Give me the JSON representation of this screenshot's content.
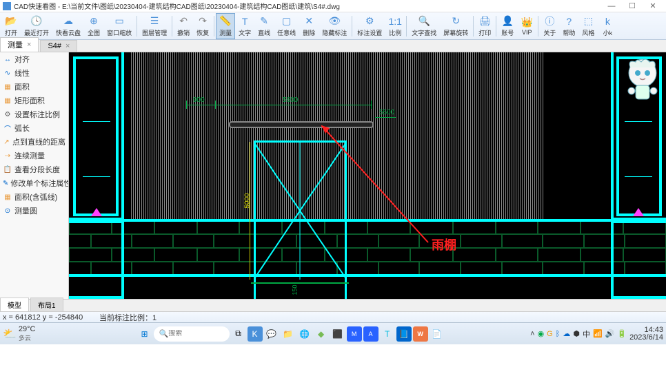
{
  "window": {
    "title": "CAD快速看图 - E:\\当前文件\\图纸\\20230404-建筑结构CAD图纸\\20230404-建筑结构CAD图纸\\建筑\\S4#.dwg",
    "min": "—",
    "max": "☐",
    "close": "✕"
  },
  "ribbon": [
    {
      "icon": "📂",
      "label": "打开",
      "c": "#4a90d9"
    },
    {
      "icon": "🕓",
      "label": "最近打开",
      "c": "#4a90d9"
    },
    {
      "icon": "☁",
      "label": "快看云盘",
      "c": "#4a90d9"
    },
    {
      "icon": "⊕",
      "label": "全图",
      "c": "#4a90d9"
    },
    {
      "icon": "▭",
      "label": "窗口缩放",
      "c": "#4a90d9"
    },
    {
      "sep": true
    },
    {
      "icon": "☰",
      "label": "图层管理",
      "c": "#4a90d9"
    },
    {
      "sep": true
    },
    {
      "icon": "↶",
      "label": "撤销",
      "c": "#888"
    },
    {
      "icon": "↷",
      "label": "恢复",
      "c": "#888"
    },
    {
      "sep": true
    },
    {
      "icon": "📏",
      "label": "测量",
      "c": "#4a90d9",
      "active": true
    },
    {
      "icon": "T",
      "label": "文字",
      "c": "#4a90d9"
    },
    {
      "icon": "✎",
      "label": "直线",
      "c": "#4a90d9"
    },
    {
      "icon": "▢",
      "label": "任意线",
      "c": "#4a90d9"
    },
    {
      "icon": "✕",
      "label": "删除",
      "c": "#4a90d9"
    },
    {
      "icon": "👁",
      "label": "隐藏标注",
      "c": "#4a90d9"
    },
    {
      "sep": true
    },
    {
      "icon": "⚙",
      "label": "标注设置",
      "c": "#4a90d9"
    },
    {
      "icon": "1:1",
      "label": "比例",
      "c": "#4a90d9"
    },
    {
      "sep": true
    },
    {
      "icon": "🔍",
      "label": "文字查找",
      "c": "#4a90d9"
    },
    {
      "icon": "↻",
      "label": "屏幕旋转",
      "c": "#4a90d9"
    },
    {
      "sep": true
    },
    {
      "icon": "🖨",
      "label": "打印",
      "c": "#4a90d9"
    },
    {
      "sep": true
    },
    {
      "icon": "👤",
      "label": "账号",
      "c": "#ea9b3e"
    },
    {
      "icon": "👑",
      "label": "VIP",
      "c": "#ea9b3e"
    },
    {
      "sep": true
    },
    {
      "icon": "ⓘ",
      "label": "关于",
      "c": "#4a90d9"
    },
    {
      "icon": "?",
      "label": "帮助",
      "c": "#4a90d9"
    },
    {
      "icon": "⬚",
      "label": "风格",
      "c": "#4a90d9"
    },
    {
      "icon": "k",
      "label": "小k",
      "c": "#4a90d9"
    }
  ],
  "tabs": [
    {
      "label": "测量",
      "active": true
    },
    {
      "label": "S4#",
      "active": false
    }
  ],
  "sidebar": [
    {
      "icon": "↔",
      "label": "对齐",
      "c": "#06c"
    },
    {
      "icon": "∿",
      "label": "线性",
      "c": "#06c"
    },
    {
      "icon": "▦",
      "label": "面积",
      "c": "#ea9b3e"
    },
    {
      "icon": "▦",
      "label": "矩形面积",
      "c": "#ea9b3e"
    },
    {
      "icon": "⚙",
      "label": "设置标注比例",
      "c": "#666"
    },
    {
      "icon": "⌒",
      "label": "弧长",
      "c": "#06c"
    },
    {
      "icon": "↗",
      "label": "点到直线的距离",
      "c": "#ea9b3e"
    },
    {
      "icon": "⇢",
      "label": "连续测量",
      "c": "#ea9b3e"
    },
    {
      "icon": "📋",
      "label": "查看分段长度",
      "c": "#ea9b3e"
    },
    {
      "icon": "✎",
      "label": "修改单个标注属性",
      "c": "#06c"
    },
    {
      "icon": "▦",
      "label": "面积(含弧线)",
      "c": "#ea9b3e"
    },
    {
      "icon": "⊙",
      "label": "测量圆",
      "c": "#06c"
    }
  ],
  "drawing": {
    "dim1": "900",
    "dim2": "5600",
    "dim3": "5500",
    "dim4": "5000",
    "dim5": "150",
    "annotation": "雨棚"
  },
  "bottomtabs": [
    {
      "label": "模型",
      "active": true
    },
    {
      "label": "布局1",
      "active": false
    }
  ],
  "status": {
    "coord": "x = 641812  y = -254840",
    "scale": "当前标注比例：1"
  },
  "taskbar": {
    "temp": "29°C",
    "weathertext": "多云",
    "searchplaceholder": "搜索",
    "time": "14:43",
    "date": "2023/6/14"
  }
}
